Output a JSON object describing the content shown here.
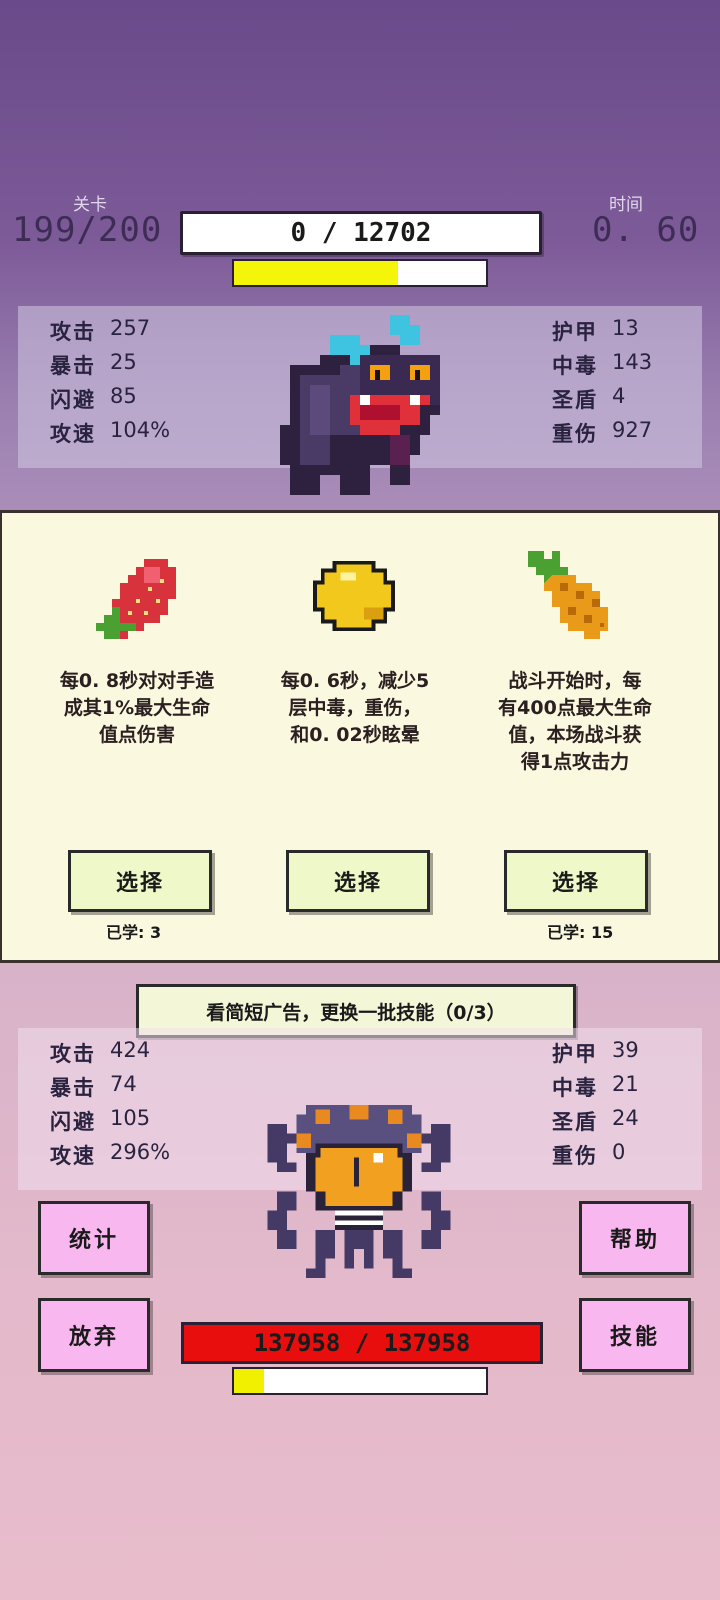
{
  "hud": {
    "level_label": "关卡",
    "level_value": "199/200",
    "time_label": "时间",
    "time_value": "0. 60",
    "enemy_hp_text": "0  /  12702",
    "enemy_progress": 0.65
  },
  "enemy_stats": {
    "left": [
      {
        "k": "攻击",
        "v": "257"
      },
      {
        "k": "暴击",
        "v": "25"
      },
      {
        "k": "闪避",
        "v": "85"
      },
      {
        "k": "攻速",
        "v": "104%"
      }
    ],
    "right": [
      {
        "k": "护甲",
        "v": "13"
      },
      {
        "k": "中毒",
        "v": "143"
      },
      {
        "k": "圣盾",
        "v": "4"
      },
      {
        "k": "重伤",
        "v": "927"
      }
    ]
  },
  "skills": [
    {
      "icon": "strawberry-icon",
      "desc": [
        "每0. 8秒对对手造",
        "成其1%最大生命",
        "值点伤害"
      ],
      "button": "选择",
      "learned": "已学: 3"
    },
    {
      "icon": "lemon-icon",
      "desc": [
        "每0. 6秒，减少5",
        "层中毒，重伤，",
        "和0. 02秒眩晕"
      ],
      "button": "选择",
      "learned": ""
    },
    {
      "icon": "pineapple-icon",
      "desc": [
        "战斗开始时，每",
        "有400点最大生命",
        "值，本场战斗获",
        "得1点攻击力"
      ],
      "button": "选择",
      "learned": "已学: 15"
    }
  ],
  "ad_button": "看简短广告，更换一批技能（0/3）",
  "player_stats": {
    "left": [
      {
        "k": "攻击",
        "v": "424"
      },
      {
        "k": "暴击",
        "v": "74"
      },
      {
        "k": "闪避",
        "v": "105"
      },
      {
        "k": "攻速",
        "v": "296%"
      }
    ],
    "right": [
      {
        "k": "护甲",
        "v": "39"
      },
      {
        "k": "中毒",
        "v": "21"
      },
      {
        "k": "圣盾",
        "v": "24"
      },
      {
        "k": "重伤",
        "v": "0"
      }
    ]
  },
  "buttons": {
    "stats": "统计",
    "give_up": "放弃",
    "help": "帮助",
    "skills": "技能"
  },
  "player": {
    "hp_text": "137958  /  137958",
    "progress": 0.12
  },
  "colors": {
    "enemy_progress": "#f5f50a",
    "player_progress": "#f0f000",
    "hp_red": "#e80e0e"
  }
}
